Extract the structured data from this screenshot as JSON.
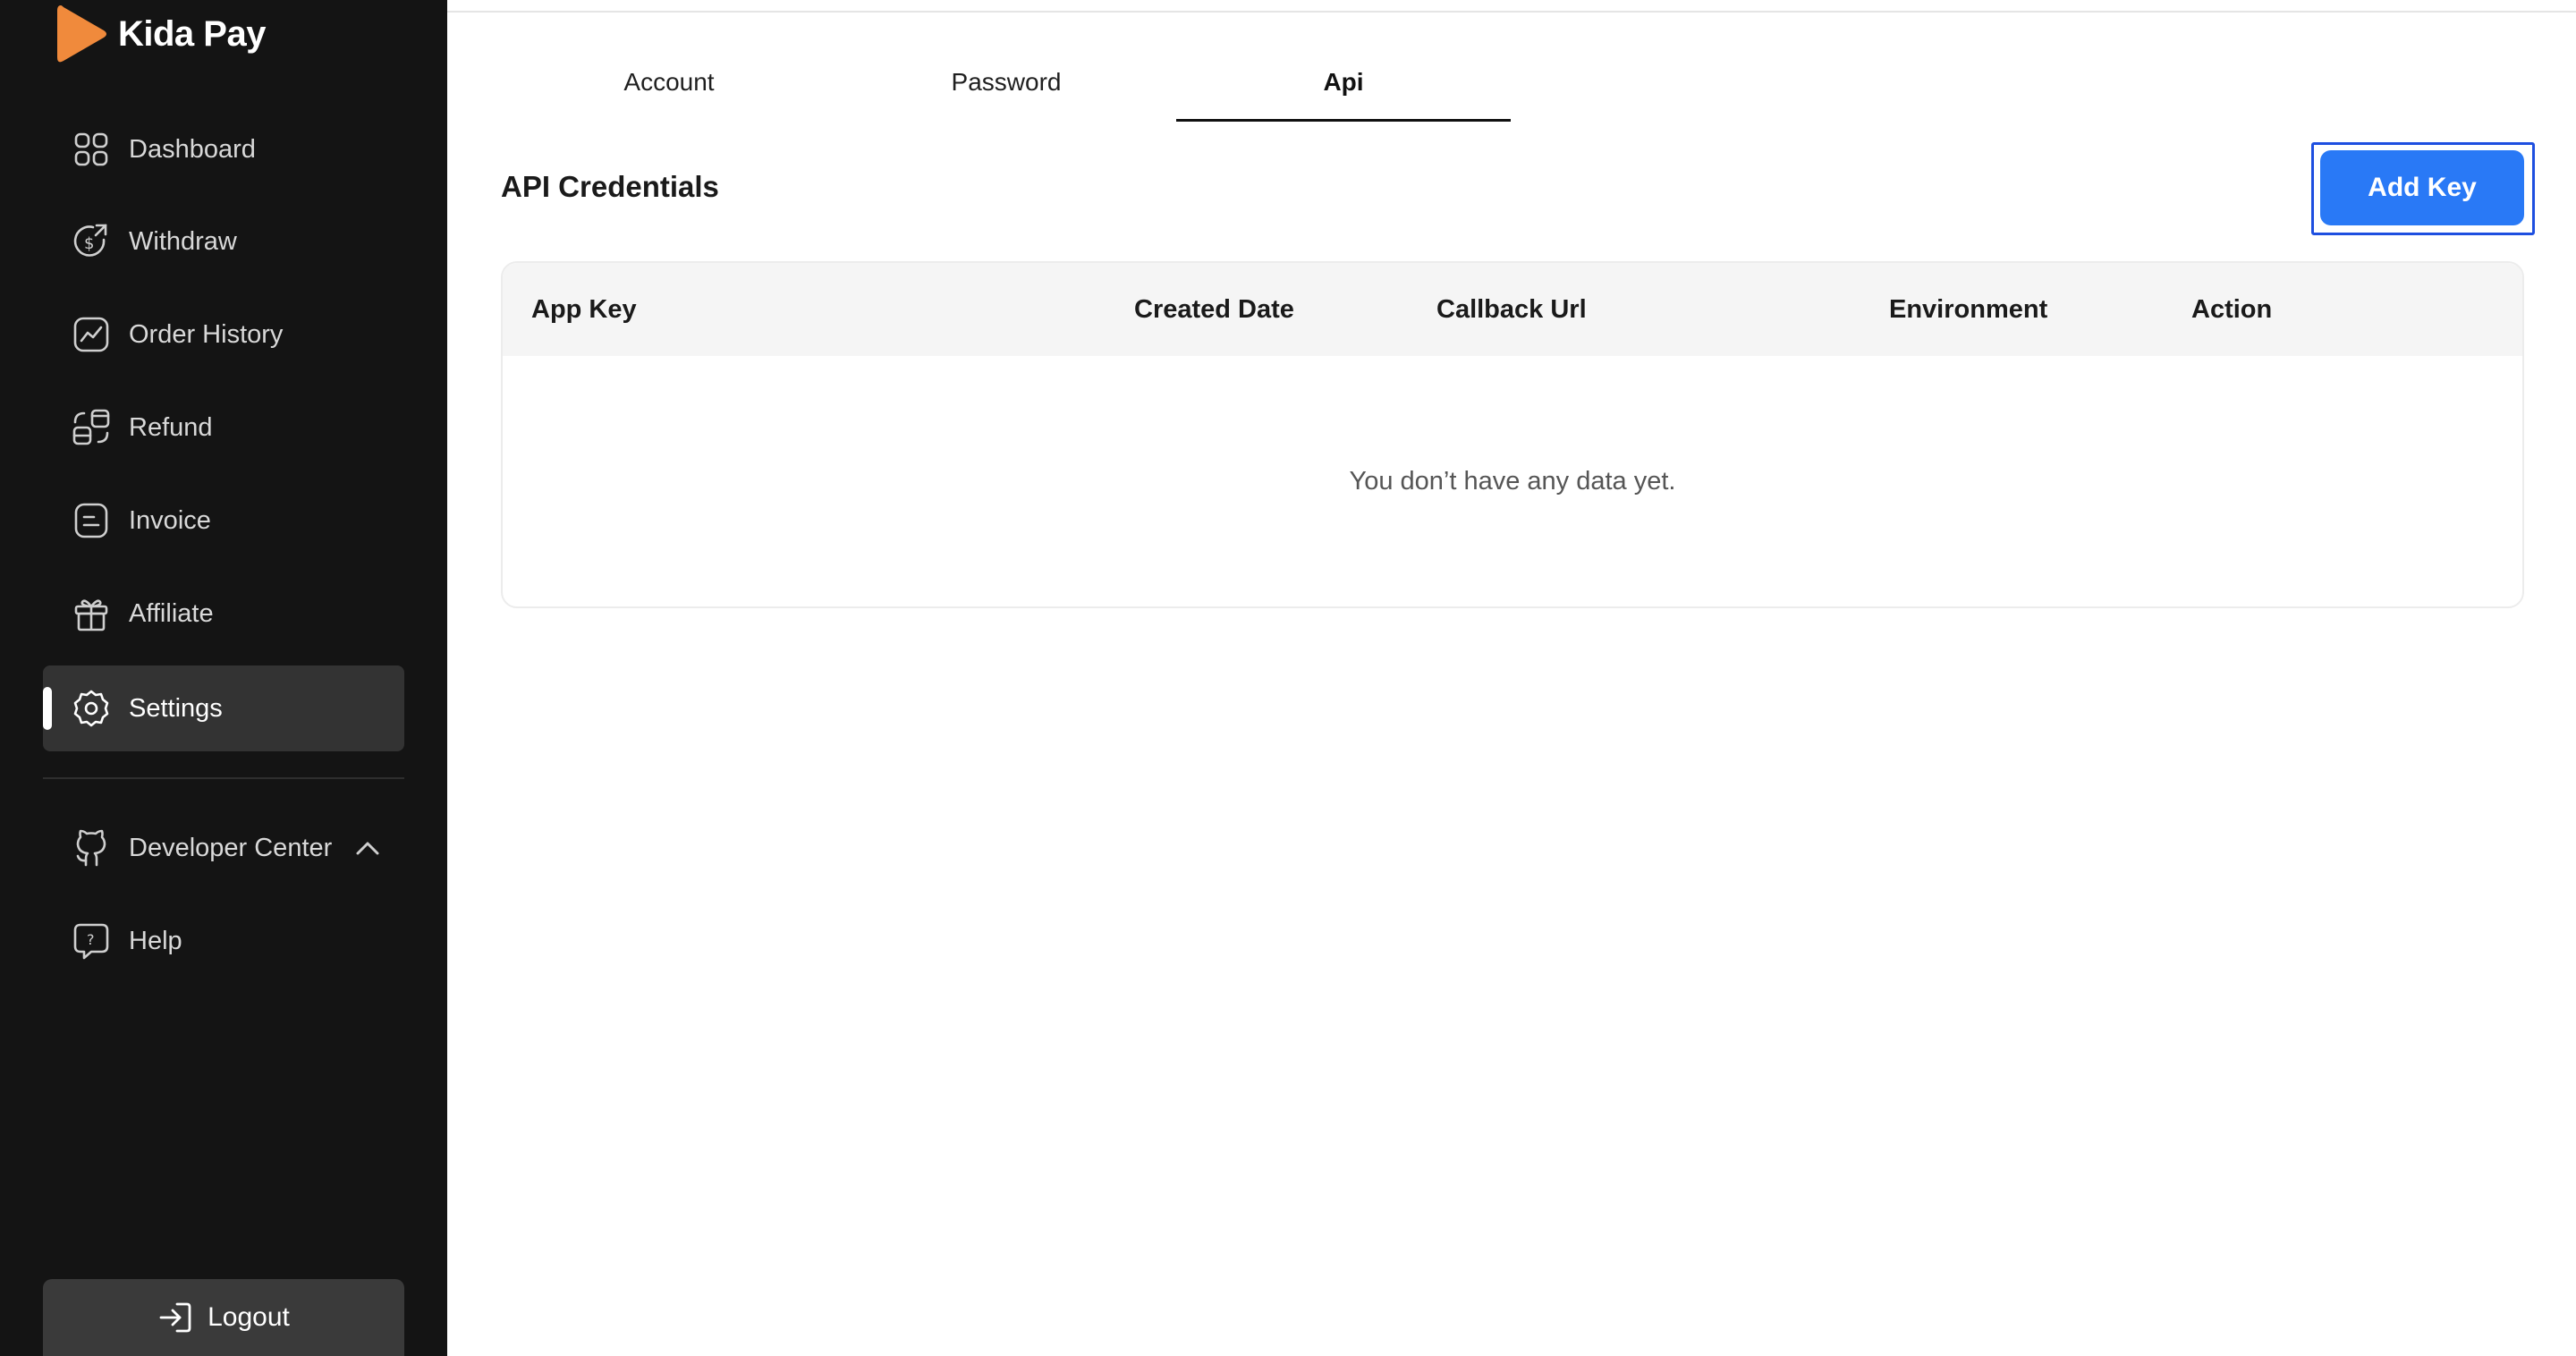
{
  "brand": {
    "name": "Kida Pay",
    "logo_color": "#f08a3c"
  },
  "sidebar": {
    "items": [
      {
        "label": "Dashboard",
        "icon": "grid-icon"
      },
      {
        "label": "Withdraw",
        "icon": "dollar-arrow-icon"
      },
      {
        "label": "Order History",
        "icon": "chart-line-icon"
      },
      {
        "label": "Refund",
        "icon": "refund-icon"
      },
      {
        "label": "Invoice",
        "icon": "invoice-icon"
      },
      {
        "label": "Affiliate",
        "icon": "gift-icon"
      },
      {
        "label": "Settings",
        "icon": "gear-icon",
        "active": true
      }
    ],
    "secondary": [
      {
        "label": "Developer Center",
        "icon": "github-icon",
        "expanded": true
      },
      {
        "label": "Help",
        "icon": "help-bubble-icon"
      }
    ],
    "logout_label": "Logout"
  },
  "tabs": [
    {
      "label": "Account"
    },
    {
      "label": "Password"
    },
    {
      "label": "Api",
      "active": true
    }
  ],
  "main": {
    "title": "API Credentials",
    "add_key_label": "Add Key",
    "accent": "#2979f6",
    "table": {
      "columns": [
        "App Key",
        "Created Date",
        "Callback Url",
        "Environment",
        "Action"
      ],
      "rows": [],
      "empty_text": "You don’t have any data yet."
    }
  }
}
